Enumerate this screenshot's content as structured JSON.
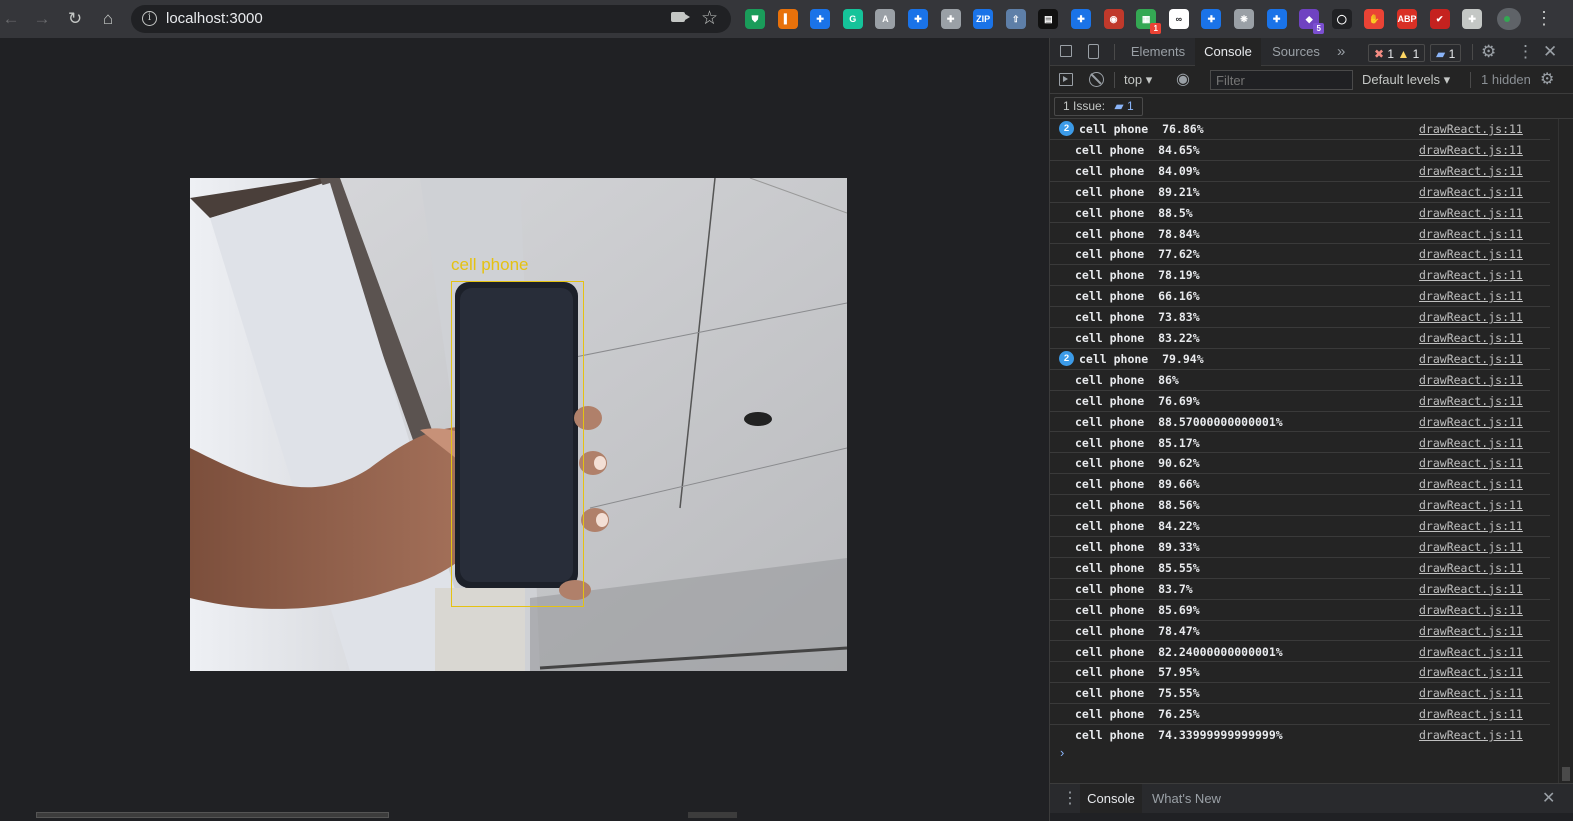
{
  "browser": {
    "url": "localhost:3000",
    "nav": {
      "back": "←",
      "forward": "→",
      "reload": "↻",
      "home": "⌂",
      "star": "☆",
      "site_info": "i",
      "menu": "⋮"
    },
    "extensions": [
      {
        "name": "ghostery-shield-icon",
        "color": "#1a9c5a",
        "glyph": "⛊",
        "badge": ""
      },
      {
        "name": "analytics-extension-icon",
        "color": "#e8710a",
        "glyph": "▍",
        "badge": ""
      },
      {
        "name": "puzzle-extension-icon",
        "color": "#1a73e8",
        "glyph": "✚",
        "badge": ""
      },
      {
        "name": "grammarly-icon",
        "color": "#15c39a",
        "glyph": "G",
        "badge": ""
      },
      {
        "name": "arrow-circle-extension-icon",
        "color": "#9aa0a6",
        "glyph": "A",
        "badge": ""
      },
      {
        "name": "puzzle-extension-icon",
        "color": "#1a73e8",
        "glyph": "✚",
        "badge": ""
      },
      {
        "name": "puzzle-extension-icon",
        "color": "#9aa0a6",
        "glyph": "✚",
        "badge": ""
      },
      {
        "name": "zip-extension-icon",
        "color": "#1a73e8",
        "glyph": "ZIP",
        "badge": ""
      },
      {
        "name": "upload-extension-icon",
        "color": "#5e7fa8",
        "glyph": "⇧",
        "badge": ""
      },
      {
        "name": "dark-box-extension-icon",
        "color": "#111111",
        "glyph": "▤",
        "badge": ""
      },
      {
        "name": "puzzle-extension-icon",
        "color": "#1a73e8",
        "glyph": "✚",
        "badge": ""
      },
      {
        "name": "glasses-extension-icon",
        "color": "#c0392b",
        "glyph": "◉",
        "badge": ""
      },
      {
        "name": "calendar-extension-icon",
        "color": "#34a853",
        "glyph": "▦",
        "badge": "1"
      },
      {
        "name": "reader-extension-icon",
        "color": "#ffffff",
        "glyph": "∞",
        "badge": ""
      },
      {
        "name": "puzzle-extension-icon",
        "color": "#1a73e8",
        "glyph": "✚",
        "badge": ""
      },
      {
        "name": "openai-extension-icon",
        "color": "#9aa0a6",
        "glyph": "❋",
        "badge": ""
      },
      {
        "name": "puzzle-extension-icon",
        "color": "#1a73e8",
        "glyph": "✚",
        "badge": ""
      },
      {
        "name": "purple-extension-icon",
        "color": "#6f42c1",
        "glyph": "◆",
        "badge": "5"
      },
      {
        "name": "circle-extension-icon",
        "color": "#202124",
        "glyph": "◯",
        "badge": ""
      },
      {
        "name": "red-hand-extension-icon",
        "color": "#ea4335",
        "glyph": "✋",
        "badge": ""
      },
      {
        "name": "adblock-plus-icon",
        "color": "#d93025",
        "glyph": "ABP",
        "badge": ""
      },
      {
        "name": "red-tool-extension-icon",
        "color": "#c5221f",
        "glyph": "✔",
        "badge": ""
      },
      {
        "name": "extensions-puzzle-icon",
        "color": "#c4c7c5",
        "glyph": "✚",
        "badge": ""
      }
    ]
  },
  "detection": {
    "label": "cell phone",
    "box_color": "#e5c212"
  },
  "devtools": {
    "tabs": {
      "elements": "Elements",
      "console": "Console",
      "sources": "Sources",
      "more": "»"
    },
    "counters": {
      "errors": "1",
      "warnings": "1",
      "messages": "1"
    },
    "toolbar": {
      "context": "top",
      "filter_placeholder": "Filter",
      "levels": "Default levels",
      "hidden": "1 hidden"
    },
    "issues": {
      "label": "1 Issue:",
      "count": "1"
    },
    "drawer": {
      "console": "Console",
      "whats_new": "What's New"
    },
    "prompt": "›"
  },
  "console_log": [
    {
      "count": "2",
      "message": "cell phone  76.86%",
      "source": "drawReact.js:11"
    },
    {
      "count": "",
      "message": "cell phone  84.65%",
      "source": "drawReact.js:11"
    },
    {
      "count": "",
      "message": "cell phone  84.09%",
      "source": "drawReact.js:11"
    },
    {
      "count": "",
      "message": "cell phone  89.21%",
      "source": "drawReact.js:11"
    },
    {
      "count": "",
      "message": "cell phone  88.5%",
      "source": "drawReact.js:11"
    },
    {
      "count": "",
      "message": "cell phone  78.84%",
      "source": "drawReact.js:11"
    },
    {
      "count": "",
      "message": "cell phone  77.62%",
      "source": "drawReact.js:11"
    },
    {
      "count": "",
      "message": "cell phone  78.19%",
      "source": "drawReact.js:11"
    },
    {
      "count": "",
      "message": "cell phone  66.16%",
      "source": "drawReact.js:11"
    },
    {
      "count": "",
      "message": "cell phone  73.83%",
      "source": "drawReact.js:11"
    },
    {
      "count": "",
      "message": "cell phone  83.22%",
      "source": "drawReact.js:11"
    },
    {
      "count": "2",
      "message": "cell phone  79.94%",
      "source": "drawReact.js:11"
    },
    {
      "count": "",
      "message": "cell phone  86%",
      "source": "drawReact.js:11"
    },
    {
      "count": "",
      "message": "cell phone  76.69%",
      "source": "drawReact.js:11"
    },
    {
      "count": "",
      "message": "cell phone  88.57000000000001%",
      "source": "drawReact.js:11"
    },
    {
      "count": "",
      "message": "cell phone  85.17%",
      "source": "drawReact.js:11"
    },
    {
      "count": "",
      "message": "cell phone  90.62%",
      "source": "drawReact.js:11"
    },
    {
      "count": "",
      "message": "cell phone  89.66%",
      "source": "drawReact.js:11"
    },
    {
      "count": "",
      "message": "cell phone  88.56%",
      "source": "drawReact.js:11"
    },
    {
      "count": "",
      "message": "cell phone  84.22%",
      "source": "drawReact.js:11"
    },
    {
      "count": "",
      "message": "cell phone  89.33%",
      "source": "drawReact.js:11"
    },
    {
      "count": "",
      "message": "cell phone  85.55%",
      "source": "drawReact.js:11"
    },
    {
      "count": "",
      "message": "cell phone  83.7%",
      "source": "drawReact.js:11"
    },
    {
      "count": "",
      "message": "cell phone  85.69%",
      "source": "drawReact.js:11"
    },
    {
      "count": "",
      "message": "cell phone  78.47%",
      "source": "drawReact.js:11"
    },
    {
      "count": "",
      "message": "cell phone  82.24000000000001%",
      "source": "drawReact.js:11"
    },
    {
      "count": "",
      "message": "cell phone  57.95%",
      "source": "drawReact.js:11"
    },
    {
      "count": "",
      "message": "cell phone  75.55%",
      "source": "drawReact.js:11"
    },
    {
      "count": "",
      "message": "cell phone  76.25%",
      "source": "drawReact.js:11"
    },
    {
      "count": "",
      "message": "cell phone  74.33999999999999%",
      "source": "drawReact.js:11"
    }
  ]
}
